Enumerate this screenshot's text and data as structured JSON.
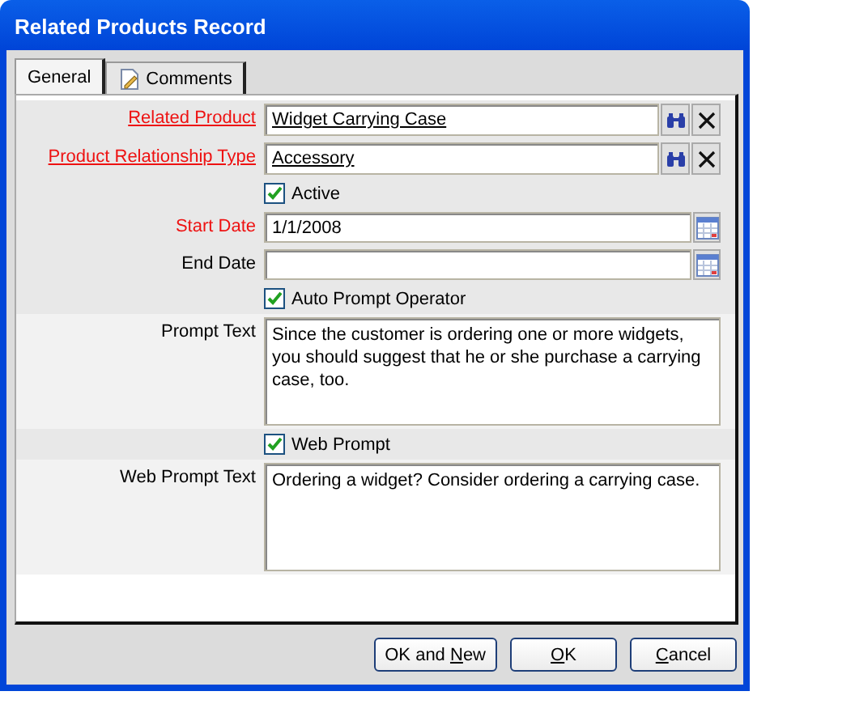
{
  "window": {
    "title": "Related Products Record"
  },
  "tabs": [
    {
      "label": "General",
      "selected": true,
      "icon": false
    },
    {
      "label": "Comments",
      "selected": false,
      "icon": true
    }
  ],
  "fields": [
    {
      "kind": "lookup",
      "label": "Related Product",
      "required": true,
      "link": true,
      "value": "Widget Carrying Case"
    },
    {
      "kind": "lookup",
      "label": "Product Relationship Type",
      "required": true,
      "link": true,
      "value": "Accessory"
    },
    {
      "kind": "checkbox",
      "label": "Active",
      "checked": true
    },
    {
      "kind": "date",
      "label": "Start Date",
      "required": true,
      "link": false,
      "value": "1/1/2008"
    },
    {
      "kind": "date",
      "label": "End Date",
      "required": false,
      "link": false
    },
    {
      "kind": "checkbox",
      "label": "Auto Prompt Operator",
      "checked": true
    },
    {
      "kind": "memo",
      "label": "Prompt Text",
      "required": false,
      "link": false,
      "value": "Since the customer is ordering one or more widgets, you should suggest that he or she purchase a carrying case, too."
    },
    {
      "kind": "checkbox",
      "label": "Web Prompt",
      "checked": true
    },
    {
      "kind": "memo",
      "label": "Web Prompt Text",
      "required": false,
      "link": false,
      "value": "Ordering a widget? Consider ordering a carrying case."
    }
  ],
  "buttons": [
    {
      "before": "OK and ",
      "access_key": "N",
      "after": "ew"
    },
    {
      "access_key": "O",
      "after": "K"
    },
    {
      "access_key": "C",
      "after": "ancel"
    }
  ]
}
